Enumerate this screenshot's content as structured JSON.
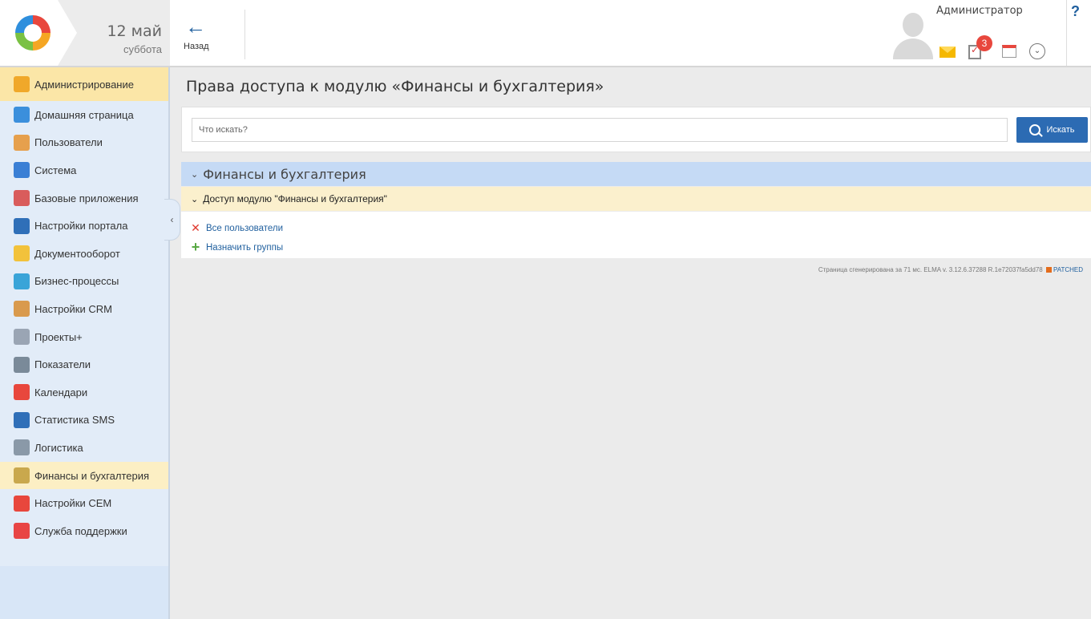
{
  "header": {
    "date_day": "12 май",
    "date_weekday": "суббота",
    "back_label": "Назад",
    "back_arrow": "←",
    "user_name": "Администратор",
    "tasks_count": "3",
    "help": "?",
    "more_glyph": "⌄"
  },
  "sidebar": {
    "items": [
      {
        "label": "Администрирование",
        "icon": "admin-key-icon",
        "color": "#f0a82a"
      },
      {
        "label": "Домашняя страница",
        "icon": "home-tiles-icon",
        "color": "#3b8fdc"
      },
      {
        "label": "Пользователи",
        "icon": "users-icon",
        "color": "#e6a04d"
      },
      {
        "label": "Система",
        "icon": "system-nodes-icon",
        "color": "#3a7fd5"
      },
      {
        "label": "Базовые приложения",
        "icon": "base-apps-icon",
        "color": "#d95c5c"
      },
      {
        "label": "Настройки портала",
        "icon": "portal-settings-icon",
        "color": "#2f6fb8"
      },
      {
        "label": "Документооборот",
        "icon": "folder-icon",
        "color": "#f2c23b"
      },
      {
        "label": "Бизнес-процессы",
        "icon": "business-process-icon",
        "color": "#3aa4d8"
      },
      {
        "label": "Настройки CRM",
        "icon": "crm-person-icon",
        "color": "#d99a4d"
      },
      {
        "label": "Проекты+",
        "icon": "projects-icon",
        "color": "#9aa5b4"
      },
      {
        "label": "Показатели",
        "icon": "gauge-icon",
        "color": "#7a8a99"
      },
      {
        "label": "Календари",
        "icon": "calendar-icon",
        "color": "#e8473d"
      },
      {
        "label": "Статистика SMS",
        "icon": "sms-stats-icon",
        "color": "#2f6fb8"
      },
      {
        "label": "Логистика",
        "icon": "globe-icon",
        "color": "#8a99a8"
      },
      {
        "label": "Финансы и бухгалтерия",
        "icon": "abacus-icon",
        "color": "#c9a84d"
      },
      {
        "label": "Настройки CEM",
        "icon": "cem-settings-icon",
        "color": "#e8473d"
      },
      {
        "label": "Служба поддержки",
        "icon": "lifebuoy-icon",
        "color": "#e84545"
      }
    ],
    "collapse_glyph": "‹"
  },
  "main": {
    "title": "Права доступа к модулю «Финансы и бухгалтерия»",
    "search": {
      "placeholder": "Что искать?",
      "button_label": "Искать"
    },
    "group_title": "Финансы и бухгалтерия",
    "sub_title": "Доступ модулю \"Финансы и бухгалтерия\"",
    "permissions": [
      {
        "label": "Все пользователи",
        "mark": "✕"
      },
      {
        "label": "Назначить группы",
        "mark": "+"
      }
    ],
    "chevron": "⌄",
    "footer": "Страница сгенерирована за 71 мс. ELMA v. 3.12.6.37288 R.1e72037fa5dd78",
    "footer_patched": "PATCHED"
  }
}
